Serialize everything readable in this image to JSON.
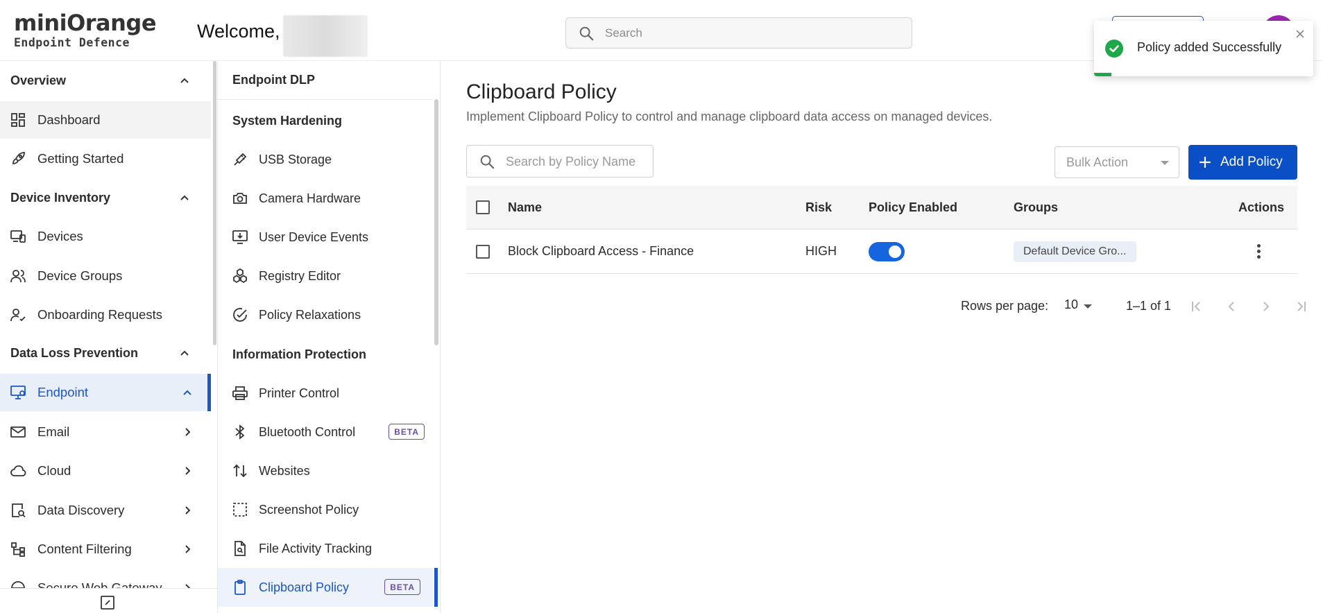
{
  "header": {
    "logo_top": "miniOrange",
    "logo_bottom": "Endpoint Defence",
    "welcome": "Welcome,",
    "search_placeholder": "Search"
  },
  "sidebar": {
    "sections": [
      {
        "label": "Overview"
      },
      {
        "label": "Device Inventory"
      },
      {
        "label": "Data Loss Prevention"
      }
    ],
    "items": [
      {
        "label": "Dashboard",
        "icon": "dashboard-icon"
      },
      {
        "label": "Getting Started",
        "icon": "rocket-icon"
      },
      {
        "label": "Devices",
        "icon": "devices-icon"
      },
      {
        "label": "Device Groups",
        "icon": "users-icon"
      },
      {
        "label": "Onboarding Requests",
        "icon": "user-check-icon"
      },
      {
        "label": "Endpoint",
        "icon": "monitor-icon"
      },
      {
        "label": "Email",
        "icon": "mail-icon"
      },
      {
        "label": "Cloud",
        "icon": "cloud-icon"
      },
      {
        "label": "Data Discovery",
        "icon": "search-file-icon"
      },
      {
        "label": "Content Filtering",
        "icon": "filter-tree-icon"
      },
      {
        "label": "Secure Web Gateway",
        "icon": "gateway-icon"
      }
    ]
  },
  "subnav": {
    "headings": [
      {
        "label": "Endpoint DLP"
      },
      {
        "label": "System Hardening"
      },
      {
        "label": "Information Protection"
      }
    ],
    "items": [
      {
        "label": "USB Storage",
        "icon": "usb-icon"
      },
      {
        "label": "Camera Hardware",
        "icon": "camera-icon"
      },
      {
        "label": "User Device Events",
        "icon": "monitor-download-icon"
      },
      {
        "label": "Registry Editor",
        "icon": "cubes-icon"
      },
      {
        "label": "Policy Relaxations",
        "icon": "check-circle-icon"
      },
      {
        "label": "Printer Control",
        "icon": "printer-icon"
      },
      {
        "label": "Bluetooth Control",
        "icon": "bluetooth-icon",
        "badge": "BETA"
      },
      {
        "label": "Websites",
        "icon": "sort-arrows-icon"
      },
      {
        "label": "Screenshot Policy",
        "icon": "screenshot-icon"
      },
      {
        "label": "File Activity Tracking",
        "icon": "file-search-icon"
      },
      {
        "label": "Clipboard Policy",
        "icon": "clipboard-icon",
        "badge": "BETA"
      }
    ]
  },
  "main": {
    "title": "Clipboard Policy",
    "description": "Implement Clipboard Policy to control and manage clipboard data access on managed devices.",
    "search_placeholder": "Search by Policy Name",
    "bulk_action": "Bulk Action",
    "add_policy": "Add Policy",
    "columns": [
      "Name",
      "Risk",
      "Policy Enabled",
      "Groups",
      "Actions"
    ],
    "rows": [
      {
        "name": "Block Clipboard Access - Finance",
        "risk": "HIGH",
        "enabled": true,
        "group": "Default Device Gro..."
      }
    ],
    "pagination": {
      "rows_per_page_label": "Rows per page:",
      "rows_per_page": "10",
      "range": "1–1 of 1"
    }
  },
  "toast": {
    "message": "Policy added Successfully",
    "progress": 0.08
  },
  "colors": {
    "primary": "#0b4fc7",
    "accent_orange": "#f08b1d",
    "success": "#1fa84a",
    "beta": "#6a4ca3"
  }
}
